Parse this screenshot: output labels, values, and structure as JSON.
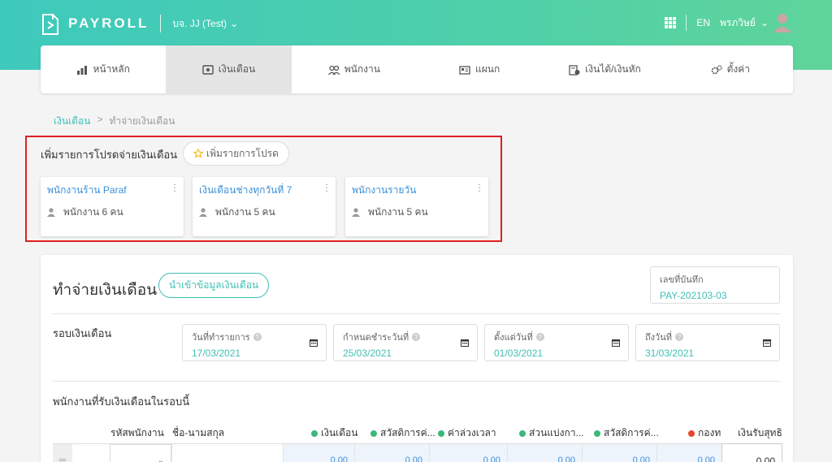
{
  "header": {
    "logo_text": "PAYROLL",
    "company": "บจ. JJ (Test)",
    "lang": "EN",
    "user": "พรภวิษย์"
  },
  "nav": [
    {
      "label": "หน้าหลัก",
      "icon": "chart-bar-icon"
    },
    {
      "label": "เงินเดือน",
      "icon": "payroll-icon"
    },
    {
      "label": "พนักงาน",
      "icon": "employees-icon"
    },
    {
      "label": "แผนก",
      "icon": "department-icon"
    },
    {
      "label": "เงินได้/เงินหัก",
      "icon": "income-deduction-icon"
    },
    {
      "label": "ตั้งค่า",
      "icon": "gear-icon"
    }
  ],
  "breadcrumb": {
    "parent": "เงินเดือน",
    "separator": ">",
    "current": "ทำจ่ายเงินเดือน"
  },
  "favorites": {
    "title": "เพิ่มรายการโปรดจ่ายเงินเดือน",
    "add_label": "เพิ่มรายการโปรด",
    "cards": [
      {
        "name": "พนักงานร้าน Paraf",
        "count": "พนักงาน 6 คน"
      },
      {
        "name": "เงินเดือนช่างทุกวันที่ 7",
        "count": "พนักงาน 5 คน"
      },
      {
        "name": "พนักงานรายวัน",
        "count": "พนักงาน 5 คน"
      }
    ]
  },
  "main": {
    "title": "ทำจ่ายเงินเดือน",
    "import_label": "นำเข้าข้อมูลเงินเดือน",
    "doc_label": "เลขที่บันทึก",
    "doc_value": "PAY-202103-03",
    "round_label": "รอบเงินเดือน",
    "dates": [
      {
        "label": "วันที่ทำรายการ",
        "value": "17/03/2021"
      },
      {
        "label": "กำหนดชำระวันที่",
        "value": "25/03/2021"
      },
      {
        "label": "ตั้งแต่วันที่",
        "value": "01/03/2021"
      },
      {
        "label": "ถึงวันที่",
        "value": "31/03/2021"
      }
    ],
    "employees_title": "พนักงานที่รับเงินเดือนในรอบนี้",
    "columns": {
      "code": "รหัสพนักงาน",
      "name": "ชื่อ-นามสกุล",
      "salary": "เงินเดือน",
      "welfare1": "สวัสดิการค่...",
      "overtime": "ค่าล่วงเวลา",
      "share": "ส่วนแบ่งกา...",
      "welfare2": "สวัสดิการค่...",
      "fund": "กองท",
      "net": "เงินรับสุทธิ"
    },
    "row": {
      "v1": "0.00",
      "v2": "0.00",
      "v3": "0.00",
      "v4": "0.00",
      "v5": "0.00",
      "v6": "0.00",
      "net": "0.00"
    }
  },
  "colors": {
    "accent": "#3fbfb5",
    "income_dot": "#3cb878",
    "deduct_dot": "#e8452c",
    "highlight": "#e02020"
  }
}
